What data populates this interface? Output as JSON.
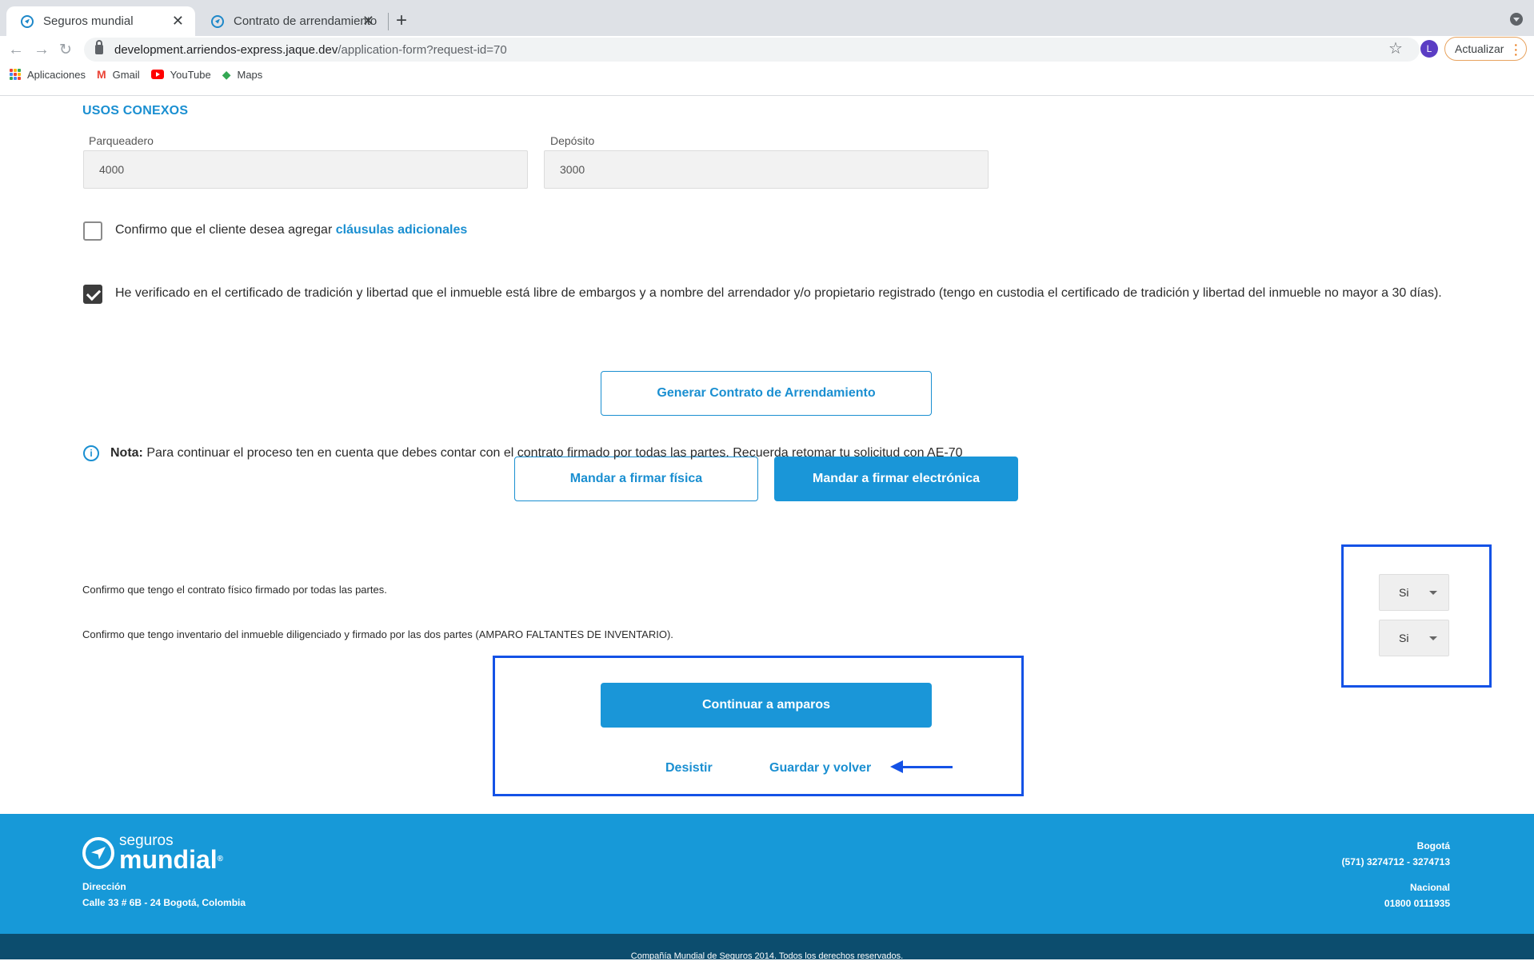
{
  "browser": {
    "tabs": [
      {
        "title": "Seguros mundial"
      },
      {
        "title": "Contrato de arrendamiento"
      }
    ],
    "url_host": "development.arriendos-express.jaque.dev",
    "url_path": "/application-form?request-id=70",
    "profile_initial": "L",
    "update_label": "Actualizar",
    "bookmarks": [
      {
        "label": "Aplicaciones"
      },
      {
        "label": "Gmail"
      },
      {
        "label": "YouTube"
      },
      {
        "label": "Maps"
      }
    ]
  },
  "form": {
    "section_title": "USOS CONEXOS",
    "parqueadero_label": "Parqueadero",
    "parqueadero_value": "4000",
    "deposito_label": "Depósito",
    "deposito_value": "3000",
    "clausulas_text": "Confirmo que el cliente desea agregar",
    "clausulas_link": "cláusulas adicionales",
    "clausulas_checked": false,
    "certificado_text": "He verificado en el certificado de tradición y libertad que el inmueble está libre de embargos y a nombre del arrendador y/o propietario registrado (tengo en custodia el certificado de tradición y libertad del inmueble no mayor a 30 días).",
    "certificado_checked": true,
    "generar_button": "Generar Contrato de Arrendamiento",
    "firma_fisica_button": "Mandar a firmar física",
    "firma_electronica_button": "Mandar a firmar electrónica",
    "note_bold": "Nota:",
    "note_text": "Para continuar el proceso ten en cuenta que debes contar con el contrato firmado por todas las partes. Recuerda retomar tu solicitud con AE-70",
    "confirm_contrato_text": "Confirmo que tengo el contrato físico firmado por todas las partes.",
    "confirm_contrato_value": "Si",
    "confirm_inventario_text": "Confirmo que tengo inventario del inmueble diligenciado y firmado por las dos partes (AMPARO FALTANTES DE INVENTARIO).",
    "confirm_inventario_value": "Si",
    "continuar_button": "Continuar a amparos",
    "desistir_link": "Desistir",
    "guardar_link": "Guardar y volver"
  },
  "footer": {
    "logo_small": "seguros",
    "logo_big": "mundial",
    "logo_reg": "®",
    "direccion_label": "Dirección",
    "direccion_value": "Calle 33 # 6B - 24 Bogotá, Colombia",
    "bogota_label": "Bogotá",
    "bogota_phones": "(571) 3274712 - 3274713",
    "nacional_label": "Nacional",
    "nacional_phone": "01800 0111935",
    "copyright": "Compañía Mundial de Seguros 2014. Todos los derechos reservados."
  },
  "colors": {
    "brand_blue": "#1a96d8",
    "highlight_blue": "#1452e6",
    "footer_dark": "#0c4d6e"
  }
}
